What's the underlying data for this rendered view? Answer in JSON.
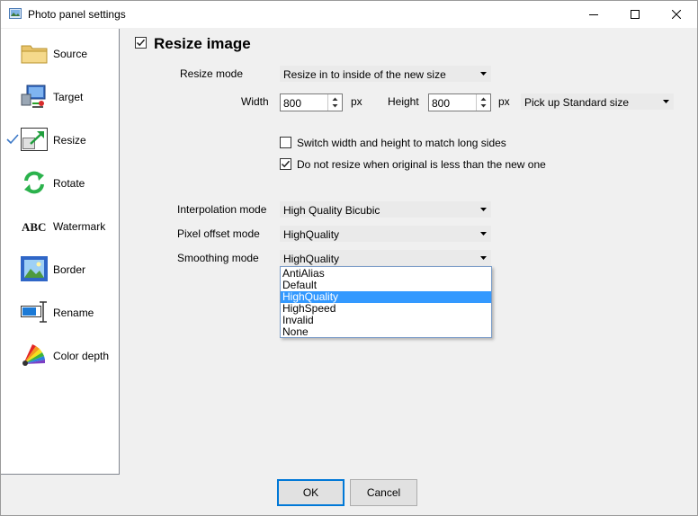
{
  "window": {
    "title": "Photo panel settings"
  },
  "sidebar": {
    "items": [
      {
        "label": "Source",
        "icon": "folder-icon"
      },
      {
        "label": "Target",
        "icon": "network-computer-icon"
      },
      {
        "label": "Resize",
        "icon": "resize-icon",
        "checked": true
      },
      {
        "label": "Rotate",
        "icon": "rotate-arrows-icon"
      },
      {
        "label": "Watermark",
        "icon": "abc-text-icon"
      },
      {
        "label": "Border",
        "icon": "framed-picture-icon"
      },
      {
        "label": "Rename",
        "icon": "text-cursor-icon"
      },
      {
        "label": "Color depth",
        "icon": "color-palette-icon"
      }
    ]
  },
  "resize": {
    "title": "Resize image",
    "mode_label": "Resize mode",
    "mode_value": "Resize in to inside of the new size",
    "width_label": "Width",
    "width_value": "800",
    "width_unit": "px",
    "height_label": "Height",
    "height_value": "800",
    "height_unit": "px",
    "standard_size_value": "Pick up Standard size",
    "switch_label": "Switch width and height to match long sides",
    "switch_checked": false,
    "no_resize_label": "Do not resize when original is less than the new one",
    "no_resize_checked": true,
    "interp_label": "Interpolation mode",
    "interp_value": "High Quality Bicubic",
    "pixel_label": "Pixel offset mode",
    "pixel_value": "HighQuality",
    "smooth_label": "Smoothing mode",
    "smooth_value": "HighQuality",
    "smooth_options": [
      "AntiAlias",
      "Default",
      "HighQuality",
      "HighSpeed",
      "Invalid",
      "None"
    ],
    "smooth_selected": "HighQuality"
  },
  "footer": {
    "ok_label": "OK",
    "cancel_label": "Cancel"
  },
  "colors": {
    "accent": "#0078d7",
    "selection": "#3399ff"
  }
}
